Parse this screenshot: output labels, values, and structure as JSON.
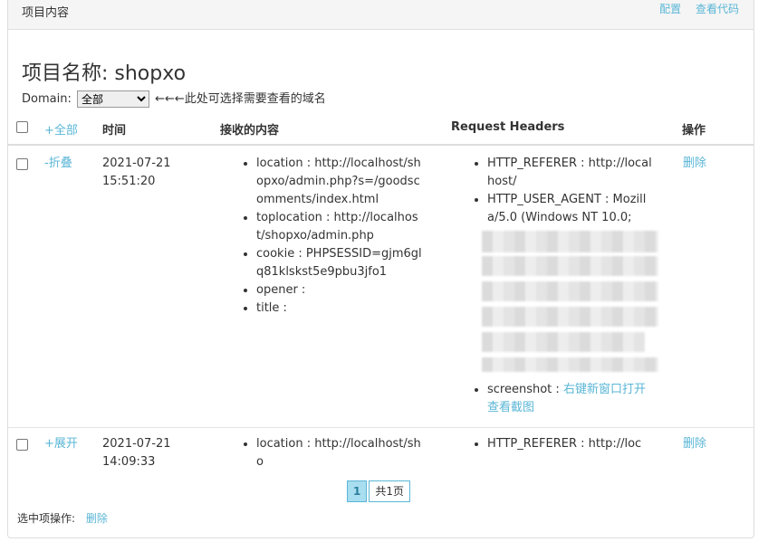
{
  "panel": {
    "title": "项目内容",
    "links": [
      "配置",
      "查看代码"
    ]
  },
  "project": {
    "title": "项目名称: shopxo"
  },
  "domain": {
    "label": "Domain:",
    "selected": "全部",
    "hint": "←←←此处可选择需要查看的域名"
  },
  "table": {
    "headers": {
      "toggle_all": "+全部",
      "time": "时间",
      "content": "接收的内容",
      "headers": "Request Headers",
      "ops": "操作"
    },
    "rows": [
      {
        "toggle": "-折叠",
        "date": "2021-07-21",
        "time": "15:51:20",
        "content": [
          "location : http://localhost/shopxo/admin.php?s=/goodscomments/index.html",
          "toplocation : http://localhost/shopxo/admin.php",
          "cookie : PHPSESSID=gjm6glq81klskst5e9pbu3jfo1",
          "opener :",
          "title :"
        ],
        "headers": [
          "HTTP_REFERER : http://localhost/",
          "HTTP_USER_AGENT : Mozilla/5.0 (Windows NT 10.0;"
        ],
        "screenshot_key": "screenshot :",
        "screenshot_link": "右键新窗口打开查看截图",
        "op": "删除"
      },
      {
        "toggle": "+展开",
        "date": "2021-07-21",
        "time": "14:09:33",
        "content": [
          "location : http://localhost/sho"
        ],
        "headers": [
          "HTTP_REFERER : http://loc"
        ],
        "op": "删除"
      }
    ]
  },
  "pager": {
    "current": "1",
    "total": "共1页"
  },
  "bottom": {
    "label": "选中项操作:",
    "action": "删除"
  }
}
